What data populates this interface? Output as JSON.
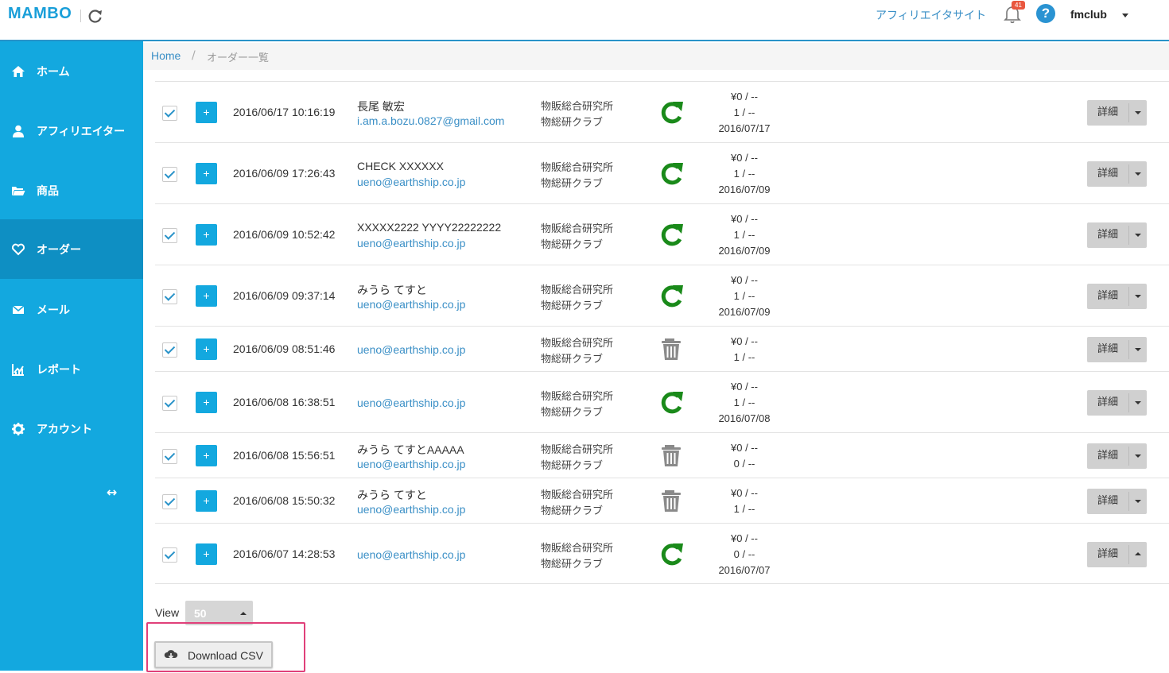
{
  "header": {
    "logo": "MAMBO",
    "affiliate_link": "アフィリエイタサイト",
    "notification_count": "41",
    "help": "?",
    "user": "fmclub"
  },
  "sidebar": {
    "items": [
      {
        "label": "ホーム",
        "icon": "home-icon"
      },
      {
        "label": "アフィリエイター",
        "icon": "user-icon"
      },
      {
        "label": "商品",
        "icon": "folder-icon"
      },
      {
        "label": "オーダー",
        "icon": "heart-icon",
        "active": true
      },
      {
        "label": "メール",
        "icon": "mail-icon"
      },
      {
        "label": "レポート",
        "icon": "chart-icon"
      },
      {
        "label": "アカウント",
        "icon": "gear-icon"
      }
    ],
    "collapse": "↔"
  },
  "breadcrumb": {
    "home": "Home",
    "sep": "/",
    "current": "オーダー一覧"
  },
  "orders": [
    {
      "date": "2016/06/17 10:16:19",
      "name": "長尾 敏宏",
      "email": "i.am.a.bozu.0827@gmail.com",
      "shop1": "物販総合研究所",
      "shop2": "物総研クラブ",
      "status": "refresh",
      "amt1": "¥0 / --",
      "amt2": "1 / --",
      "amt3": "2016/07/17",
      "detail": "詳細",
      "caret": "down"
    },
    {
      "date": "2016/06/09 17:26:43",
      "name": "CHECK XXXXXX",
      "email": "ueno@earthship.co.jp",
      "shop1": "物販総合研究所",
      "shop2": "物総研クラブ",
      "status": "refresh",
      "amt1": "¥0 / --",
      "amt2": "1 / --",
      "amt3": "2016/07/09",
      "detail": "詳細",
      "caret": "down"
    },
    {
      "date": "2016/06/09 10:52:42",
      "name": "XXXXX2222 YYYY22222222",
      "email": "ueno@earthship.co.jp",
      "shop1": "物販総合研究所",
      "shop2": "物総研クラブ",
      "status": "refresh",
      "amt1": "¥0 / --",
      "amt2": "1 / --",
      "amt3": "2016/07/09",
      "detail": "詳細",
      "caret": "down"
    },
    {
      "date": "2016/06/09 09:37:14",
      "name": "みうら てすと",
      "email": "ueno@earthship.co.jp",
      "shop1": "物販総合研究所",
      "shop2": "物総研クラブ",
      "status": "refresh",
      "amt1": "¥0 / --",
      "amt2": "1 / --",
      "amt3": "2016/07/09",
      "detail": "詳細",
      "caret": "down"
    },
    {
      "date": "2016/06/09 08:51:46",
      "name": "",
      "email": "ueno@earthship.co.jp",
      "shop1": "物販総合研究所",
      "shop2": "物総研クラブ",
      "status": "trash",
      "amt1": "¥0 / --",
      "amt2": "1 / --",
      "amt3": "",
      "detail": "詳細",
      "caret": "down"
    },
    {
      "date": "2016/06/08 16:38:51",
      "name": "",
      "email": "ueno@earthship.co.jp",
      "shop1": "物販総合研究所",
      "shop2": "物総研クラブ",
      "status": "refresh",
      "amt1": "¥0 / --",
      "amt2": "1 / --",
      "amt3": "2016/07/08",
      "detail": "詳細",
      "caret": "down"
    },
    {
      "date": "2016/06/08 15:56:51",
      "name": "みうら てすとAAAAA",
      "email": "ueno@earthship.co.jp",
      "shop1": "物販総合研究所",
      "shop2": "物総研クラブ",
      "status": "trash",
      "amt1": "¥0 / --",
      "amt2": "0 / --",
      "amt3": "",
      "detail": "詳細",
      "caret": "down"
    },
    {
      "date": "2016/06/08 15:50:32",
      "name": "みうら てすと",
      "email": "ueno@earthship.co.jp",
      "shop1": "物販総合研究所",
      "shop2": "物総研クラブ",
      "status": "trash",
      "amt1": "¥0 / --",
      "amt2": "1 / --",
      "amt3": "",
      "detail": "詳細",
      "caret": "down"
    },
    {
      "date": "2016/06/07 14:28:53",
      "name": "",
      "email": "ueno@earthship.co.jp",
      "shop1": "物販総合研究所",
      "shop2": "物総研クラブ",
      "status": "refresh",
      "amt1": "¥0 / --",
      "amt2": "0 / --",
      "amt3": "2016/07/07",
      "detail": "詳細",
      "caret": "up"
    }
  ],
  "footer": {
    "view_label": "View",
    "view_value": "50",
    "csv_label": "Download CSV"
  },
  "colors": {
    "sidebar": "#13a8df",
    "sidebar_active": "#0e8fc3",
    "link": "#3a8fc6",
    "refresh_green": "#1a8a1a",
    "trash_gray": "#8a8a8a",
    "highlight": "#e0407a"
  }
}
